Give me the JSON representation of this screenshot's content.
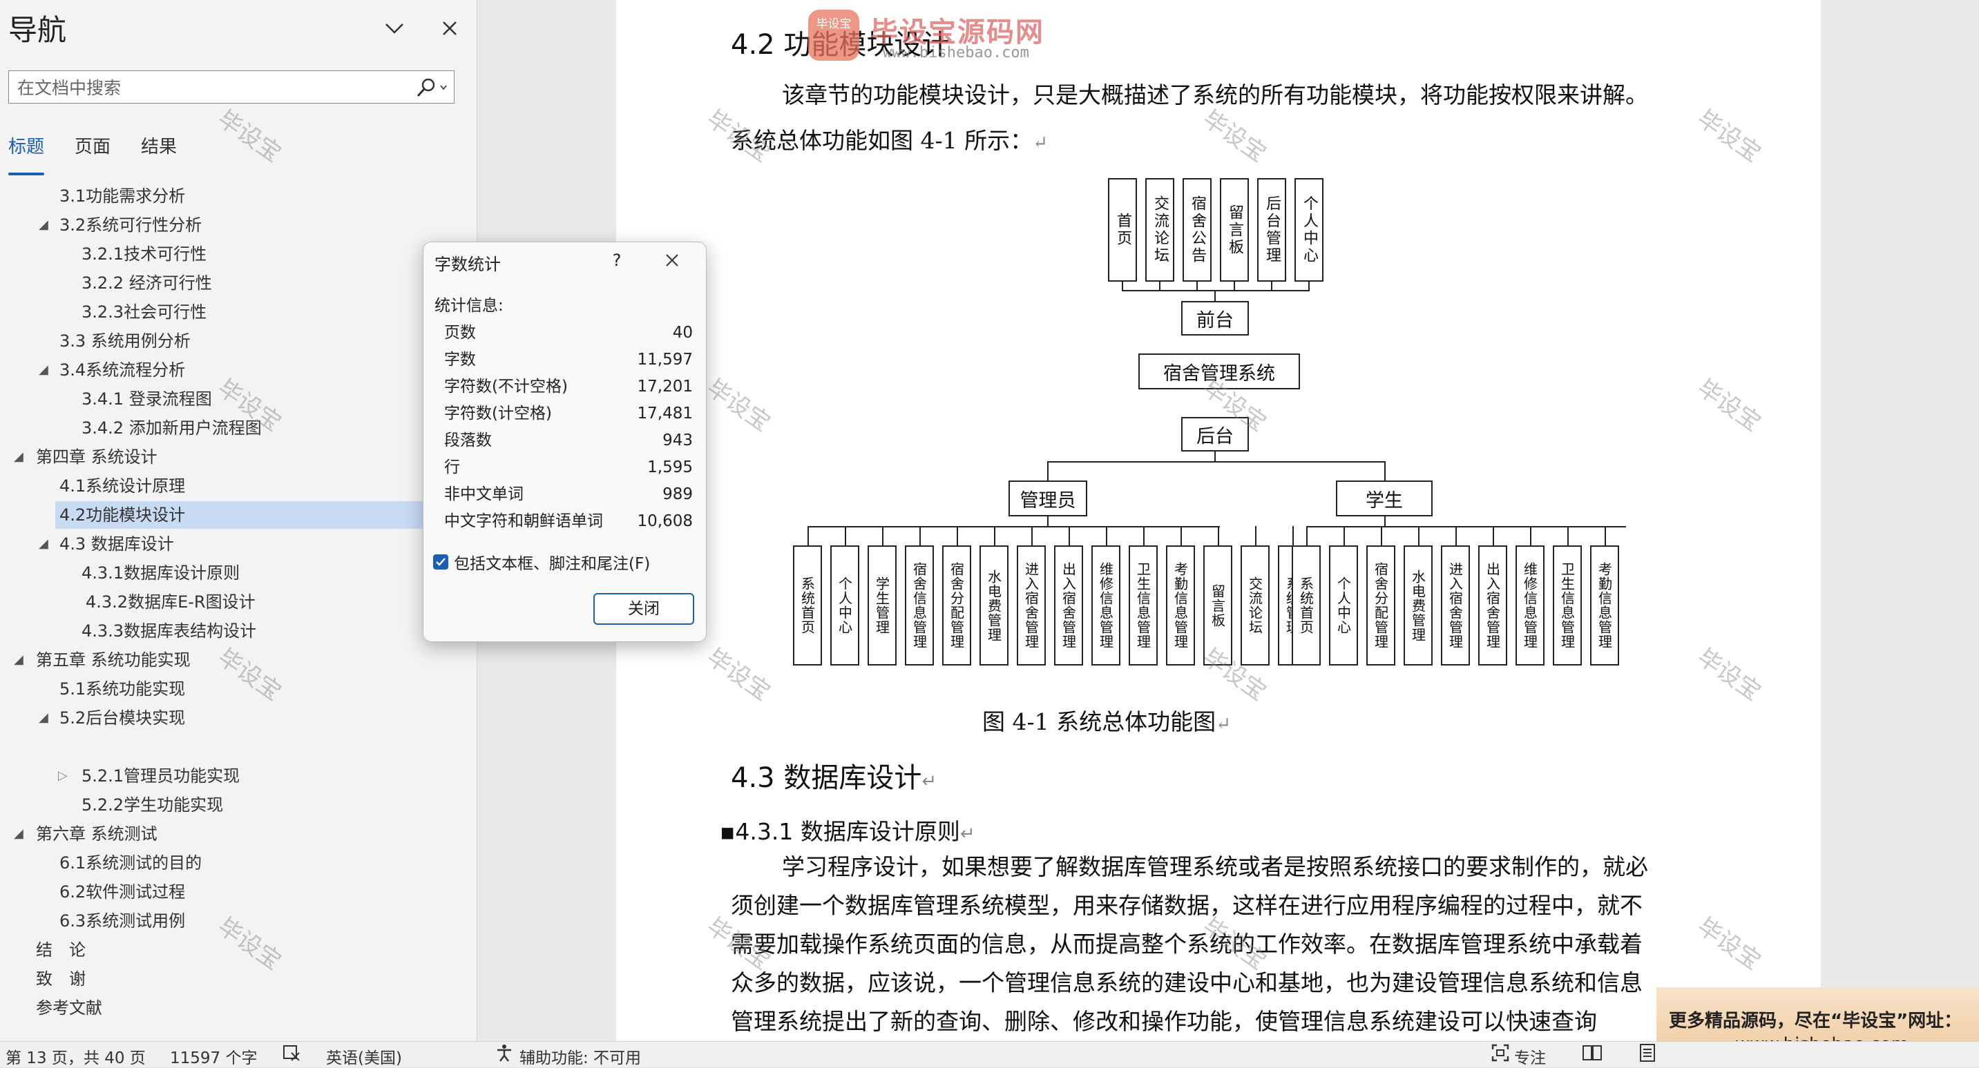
{
  "nav": {
    "title": "导航",
    "search_placeholder": "在文档中搜索",
    "tabs": [
      "标题",
      "页面",
      "结果"
    ],
    "items": [
      {
        "label": "3.1功能需求分析"
      },
      {
        "label": "3.2系统可行性分析"
      },
      {
        "label": "3.2.1技术可行性"
      },
      {
        "label": "3.2.2 经济可行性"
      },
      {
        "label": "3.2.3社会可行性"
      },
      {
        "label": "3.3 系统用例分析"
      },
      {
        "label": "3.4系统流程分析"
      },
      {
        "label": "3.4.1 登录流程图"
      },
      {
        "label": "3.4.2 添加新用户流程图"
      },
      {
        "label": "第四章 系统设计"
      },
      {
        "label": "4.1系统设计原理"
      },
      {
        "label": "4.2功能模块设计"
      },
      {
        "label": "4.3 数据库设计"
      },
      {
        "label": "4.3.1数据库设计原则"
      },
      {
        "label": "4.3.2数据库E-R图设计"
      },
      {
        "label": "4.3.3数据库表结构设计"
      },
      {
        "label": "第五章 系统功能实现"
      },
      {
        "label": "5.1系统功能实现"
      },
      {
        "label": "5.2后台模块实现"
      },
      {
        "label": "5.2.1管理员功能实现"
      },
      {
        "label": "5.2.2学生功能实现"
      },
      {
        "label": "第六章 系统测试"
      },
      {
        "label": "6.1系统测试的目的"
      },
      {
        "label": "6.2软件测试过程"
      },
      {
        "label": "6.3系统测试用例"
      },
      {
        "label": "结　论"
      },
      {
        "label": "致　谢"
      },
      {
        "label": "参考文献"
      }
    ]
  },
  "dialog": {
    "title": "字数统计",
    "help": "?",
    "section": "统计信息:",
    "stats": [
      {
        "label": "页数",
        "value": "40"
      },
      {
        "label": "字数",
        "value": "11,597"
      },
      {
        "label": "字符数(不计空格)",
        "value": "17,201"
      },
      {
        "label": "字符数(计空格)",
        "value": "17,481"
      },
      {
        "label": "段落数",
        "value": "943"
      },
      {
        "label": "行",
        "value": "1,595"
      },
      {
        "label": "非中文单词",
        "value": "989"
      },
      {
        "label": "中文字符和朝鲜语单词",
        "value": "10,608"
      }
    ],
    "checkbox_label": "包括文本框、脚注和尾注(F)",
    "checkbox_checked": true,
    "close_label": "关闭"
  },
  "document": {
    "heading_42": "4.2 功能模块设计",
    "para1": "该章节的功能模块设计，只是大概描述了系统的所有功能模块，将功能按权限来讲解。",
    "para2": "系统总体功能如图 4-1 所示：",
    "diagram": {
      "front_modules": [
        "首页",
        "交流论坛",
        "宿舍公告",
        "留言板",
        "后台管理",
        "个人中心"
      ],
      "front_label": "前台",
      "system_label": "宿舍管理系统",
      "back_label": "后台",
      "admin_label": "管理员",
      "student_label": "学生",
      "admin_modules": [
        "系统首页",
        "个人中心",
        "学生管理",
        "宿舍信息管理",
        "宿舍分配管理",
        "水电费管理",
        "进入宿舍管理",
        "出入宿舍管理",
        "维修信息管理",
        "卫生信息管理",
        "考勤信息管理",
        "留言板",
        "交流论坛",
        "系统管理"
      ],
      "student_modules": [
        "系统首页",
        "个人中心",
        "宿舍分配管理",
        "水电费管理",
        "进入宿舍管理",
        "出入宿舍管理",
        "维修信息管理",
        "卫生信息管理",
        "考勤信息管理"
      ]
    },
    "figure_caption": "图 4-1  系统总体功能图",
    "heading_43": "4.3  数据库设计",
    "heading_431": "4.3.1 数据库设计原则",
    "body_lines": [
      "学习程序设计，如果想要了解数据库管理系统或者是按照系统接口的要求制作的，就必",
      "须创建一个数据库管理系统模型，用来存储数据，这样在进行应用程序编程的过程中，就不",
      "需要加载操作系统页面的信息，从而提高整个系统的工作效率。在数据库管理系统中承载着",
      "众多的数据，应该说，一个管理信息系统的建设中心和基地，也为建设管理信息系统和信息",
      "管理系统提出了新的查询、删除、修改和操作功能，使管理信息系统建设可以快速查询"
    ],
    "watermark": "毕设宝",
    "logo_badge": "毕设宝",
    "logo_name": "毕设宝源码网",
    "logo_url": "www.bishebao.com"
  },
  "ad": {
    "line1": "更多精品源码，尽在“毕设宝”网址：",
    "line2": "www.bishebao.com"
  },
  "status": {
    "page": "第 13 页，共 40 页",
    "words": "11597 个字",
    "language": "英语(美国)",
    "accessibility": "辅助功能: 不可用",
    "focus": "专注"
  },
  "colors": {
    "accent": "#1b5fb0",
    "selected_item": "#c9daf3",
    "ad_banner": "#f0c99c"
  }
}
